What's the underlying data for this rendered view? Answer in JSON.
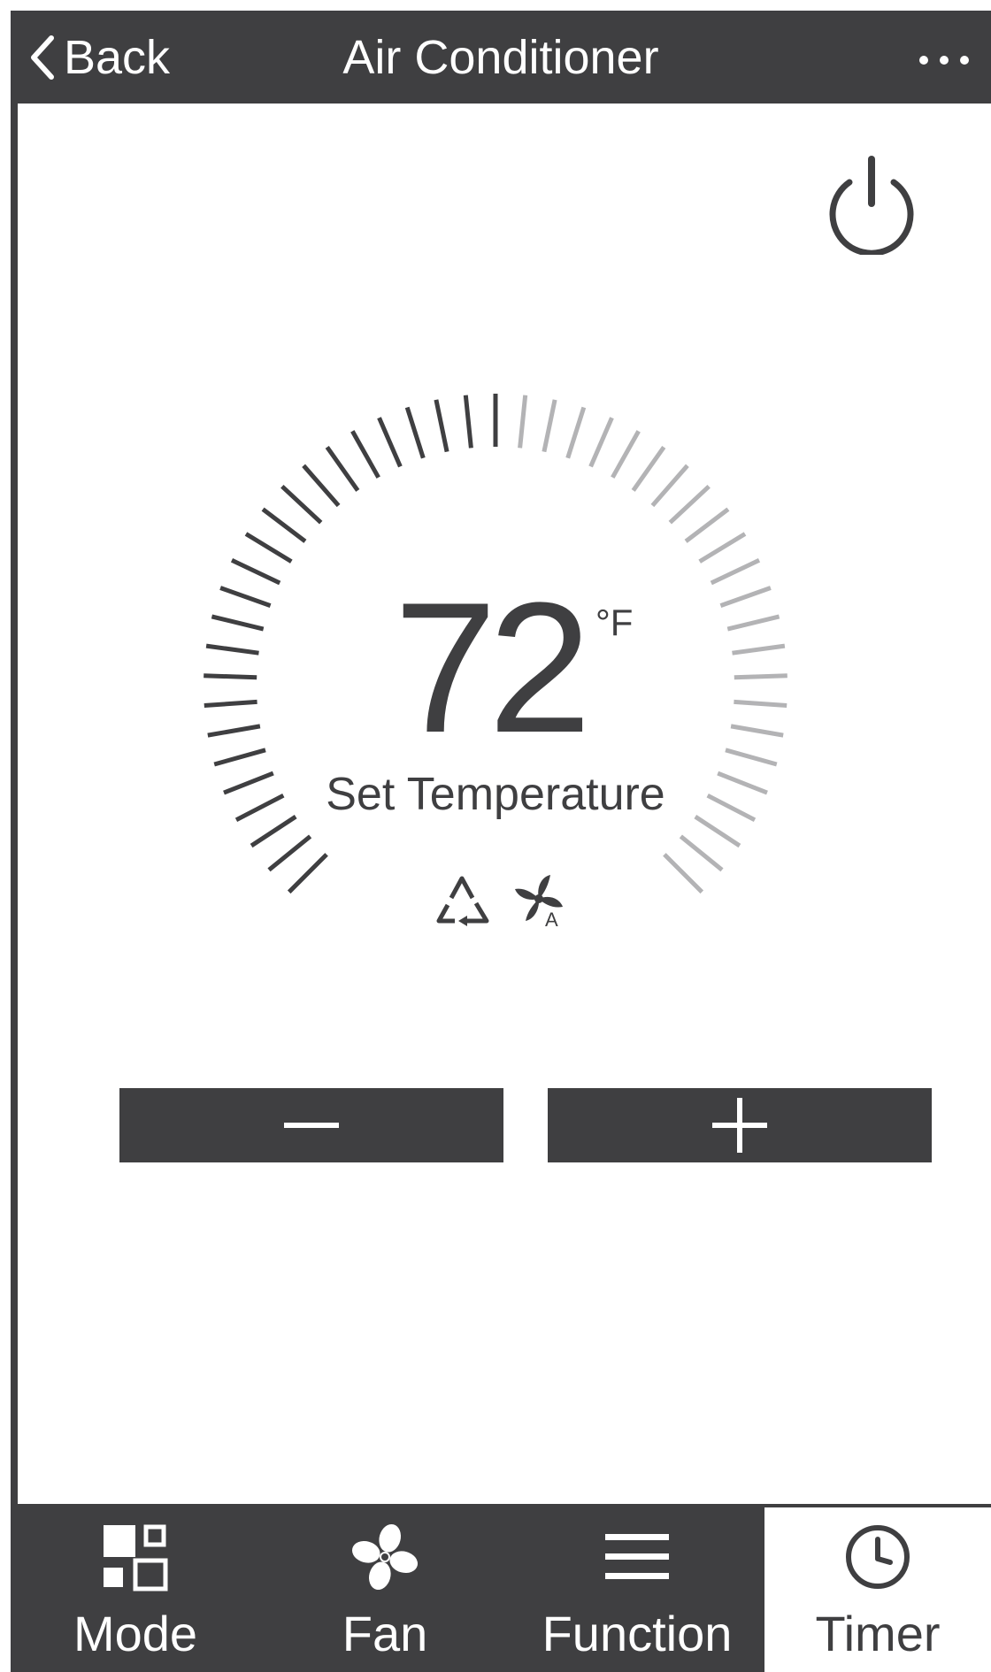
{
  "header": {
    "back_label": "Back",
    "title": "Air Conditioner",
    "back_icon": "chevron-left-icon",
    "more_icon": "more-horizontal-icon"
  },
  "power": {
    "icon": "power-icon"
  },
  "temperature": {
    "value": "72",
    "unit": "°F",
    "label": "Set Temperature",
    "setpoint_fraction": 0.5
  },
  "status_icons": [
    "recycle-icon",
    "fan-auto-icon"
  ],
  "fan_auto_label": "A",
  "controls": {
    "decrease_icon": "minus-icon",
    "increase_icon": "plus-icon"
  },
  "tabs": [
    {
      "label": "Mode",
      "icon": "mode-icon",
      "active": false
    },
    {
      "label": "Fan",
      "icon": "fan-icon",
      "active": false
    },
    {
      "label": "Function",
      "icon": "menu-icon",
      "active": false
    },
    {
      "label": "Timer",
      "icon": "clock-icon",
      "active": true
    }
  ],
  "colors": {
    "dark": "#3f3f41",
    "tick_active": "#3f3f41",
    "tick_inactive": "#b3b3b5",
    "background": "#ffffff"
  }
}
